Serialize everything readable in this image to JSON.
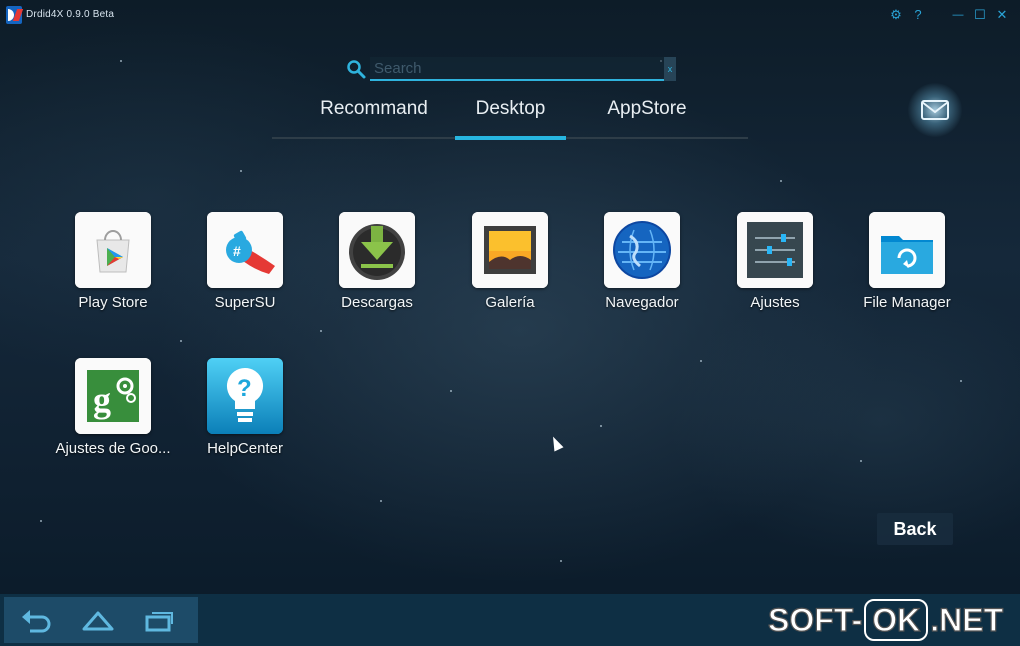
{
  "window": {
    "title": "Drdid4X 0.9.0 Beta",
    "controls": {
      "settings": "⚙",
      "help": "?",
      "minimize": "—",
      "maximize": "☐",
      "close": "✕"
    }
  },
  "search": {
    "placeholder": "Search",
    "value": "",
    "clear_label": "x"
  },
  "tabs": [
    {
      "label": "Recommand",
      "active": false
    },
    {
      "label": "Desktop",
      "active": true
    },
    {
      "label": "AppStore",
      "active": false
    }
  ],
  "accent_color": "#27b6e0",
  "apps": [
    {
      "label": "Play Store",
      "icon": "play-store-icon"
    },
    {
      "label": "SuperSU",
      "icon": "supersu-icon"
    },
    {
      "label": "Descargas",
      "icon": "download-icon"
    },
    {
      "label": "Galería",
      "icon": "gallery-icon"
    },
    {
      "label": "Navegador",
      "icon": "globe-icon"
    },
    {
      "label": "Ajustes",
      "icon": "settings-sliders-icon"
    },
    {
      "label": "File Manager",
      "icon": "folder-refresh-icon"
    },
    {
      "label": "Ajustes de Goo...",
      "icon": "google-settings-icon"
    },
    {
      "label": "HelpCenter",
      "icon": "help-bulb-icon"
    }
  ],
  "back_button": {
    "label": "Back"
  },
  "navbar": {
    "buttons": [
      "back-arrow-icon",
      "home-icon",
      "recent-apps-icon"
    ]
  },
  "watermark": {
    "prefix": "SOFT-",
    "boxed": "OK",
    "suffix": ".NET"
  }
}
